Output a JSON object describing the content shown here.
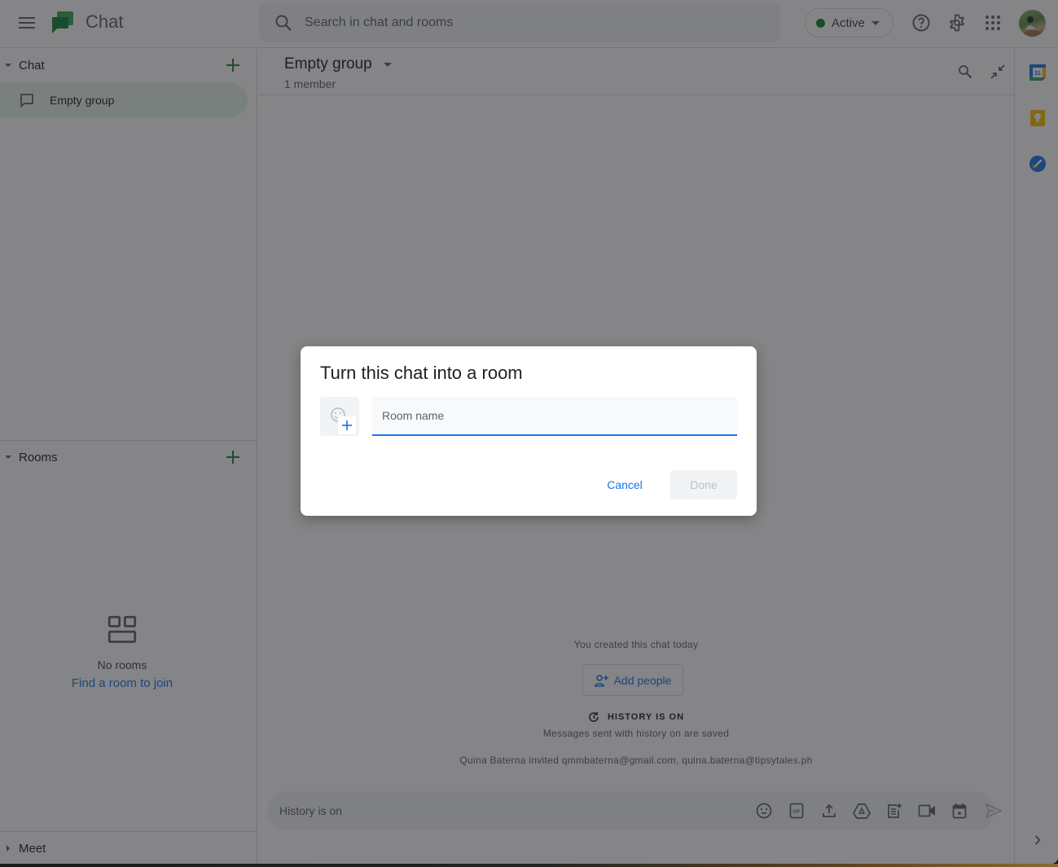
{
  "app": {
    "title": "Chat",
    "menu_icon": "hamburger-menu-icon",
    "logo_icon": "google-chat-logo-icon"
  },
  "search": {
    "placeholder": "Search in chat and rooms",
    "value": ""
  },
  "status": {
    "label": "Active",
    "color": "#188038"
  },
  "topbar_icons": [
    "help-icon",
    "settings-gear-icon",
    "apps-grid-icon",
    "account-avatar"
  ],
  "sidebar": {
    "chat_section": {
      "label": "Chat",
      "expanded": true,
      "items": [
        {
          "label": "Empty group",
          "selected": true
        }
      ]
    },
    "rooms_section": {
      "label": "Rooms",
      "expanded": true,
      "empty_text": "No rooms",
      "find_link": "Find a room to join"
    },
    "meet_section": {
      "label": "Meet",
      "expanded": false
    }
  },
  "conversation": {
    "title": "Empty group",
    "subtitle": "1 member",
    "created_text": "You created this chat today",
    "add_people_label": "Add people",
    "history_heading": "HISTORY IS ON",
    "history_sub": "Messages sent with history on are saved",
    "invited_text": "Quina Baterna invited qmmbaterna@gmail.com, quina.baterna@tipsytales.ph"
  },
  "composer": {
    "placeholder": "History is on",
    "value": "",
    "actions": [
      "emoji-icon",
      "gif-icon",
      "upload-icon",
      "google-drive-icon",
      "doc-add-icon",
      "video-meeting-icon",
      "calendar-invite-icon",
      "send-icon"
    ]
  },
  "right_rail": {
    "apps": [
      "google-calendar",
      "google-keep",
      "google-tasks"
    ],
    "calendar_day": "31"
  },
  "dialog": {
    "title": "Turn this chat into a room",
    "room_name_placeholder": "Room name",
    "room_name_value": "",
    "cancel_label": "Cancel",
    "done_label": "Done",
    "done_enabled": false
  },
  "colors": {
    "accent_blue": "#1a73e8",
    "brand_green": "#188038",
    "selected_bg": "#e6f4ea"
  }
}
